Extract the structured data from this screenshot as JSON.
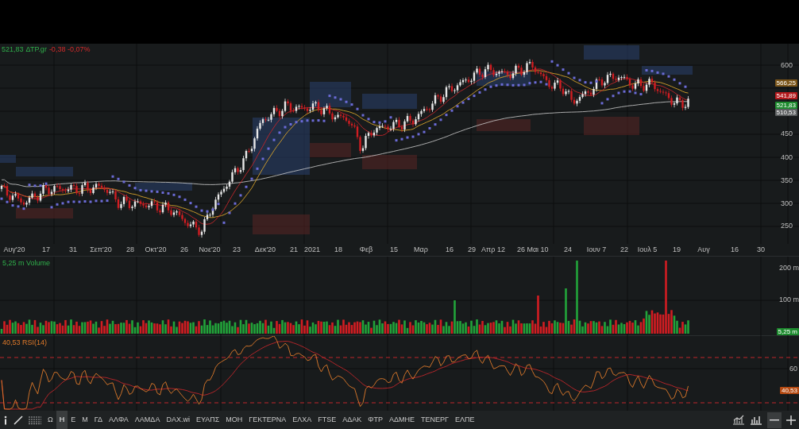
{
  "header": {
    "last": "521,83",
    "symbol": "ΔΤΡ.gr",
    "change": "-0,38 -0,07%"
  },
  "price_axis": [
    "600",
    "450",
    "400",
    "350",
    "300",
    "250"
  ],
  "price_badges": [
    {
      "text": "566,25",
      "color": "#7a5418"
    },
    {
      "text": "541,89",
      "color": "#b3191c"
    },
    {
      "text": "521,83",
      "color": "#1d8a2e"
    },
    {
      "text": "510,53",
      "color": "#5c5f60"
    }
  ],
  "time_axis": [
    "Αυγ'20",
    "17",
    "31",
    "Σεπ'20",
    "28",
    "Οκτ'20",
    "26",
    "Νοε'20",
    "23",
    "Δεκ'20",
    "21",
    "2021",
    "18",
    "Φεβ",
    "15",
    "Μαρ",
    "16",
    "29",
    "Απρ 12",
    "26",
    "Μαι 10",
    "24",
    "Ιουν 7",
    "22",
    "Ιουλ 5",
    "19",
    "Αυγ",
    "16",
    "30"
  ],
  "volume": {
    "title": "5,25 m Volume",
    "axis": [
      "200 m",
      "100 m"
    ],
    "badge": "5,25 m"
  },
  "rsi": {
    "title": "40,53 RSI(14)",
    "axis": [
      "60"
    ],
    "badge": "40,53"
  },
  "symbols": [
    {
      "label": "Ω",
      "selected": false
    },
    {
      "label": "Η",
      "selected": true
    },
    {
      "label": "Ε",
      "selected": false
    },
    {
      "label": "Μ",
      "selected": false
    },
    {
      "label": "ΓΔ",
      "selected": false
    },
    {
      "label": "ΑΛΦΑ",
      "selected": false
    },
    {
      "label": "ΛΑΜΔΑ",
      "selected": false
    },
    {
      "label": "DAX.wi",
      "selected": false
    },
    {
      "label": "ΕΥΑΠΣ",
      "selected": false
    },
    {
      "label": "ΜΟΗ",
      "selected": false
    },
    {
      "label": "ΓΕΚΤΕΡΝΑ",
      "selected": false
    },
    {
      "label": "ΕΛΧΑ",
      "selected": false
    },
    {
      "label": "FTSE",
      "selected": false
    },
    {
      "label": "ΑΔΑΚ",
      "selected": false
    },
    {
      "label": "ΦΤΡ",
      "selected": false
    },
    {
      "label": "ΑΔΜΗΕ",
      "selected": false
    },
    {
      "label": "ΤΕΝΕΡΓ",
      "selected": false
    },
    {
      "label": "ΕΛΠΕ",
      "selected": false
    }
  ]
}
